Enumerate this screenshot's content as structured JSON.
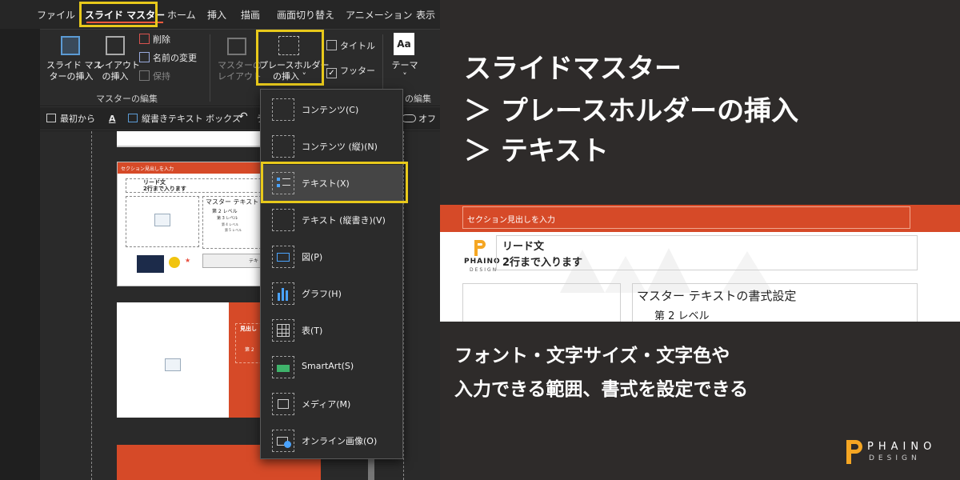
{
  "menubar": {
    "tabs": [
      "ファイル",
      "スライド マスター",
      "ホーム",
      "挿入",
      "描画",
      "画面切り替え",
      "アニメーション",
      "表示"
    ],
    "active_tab": "スライド マスター",
    "accent": "#ff5a3c"
  },
  "ribbon": {
    "insert_slide_master": [
      "スライド マス",
      "ターの挿入"
    ],
    "insert_layout": [
      "レイアウト",
      "の挿入"
    ],
    "delete": "削除",
    "rename": "名前の変更",
    "preserve": "保持",
    "master_layout": [
      "マスターの",
      "レイアウト"
    ],
    "insert_placeholder": [
      "プレースホルダー",
      "の挿入 ˅"
    ],
    "title_checkbox": "タイトル",
    "footer_checkbox": "フッター",
    "theme": "テーマ",
    "theme_icon_text": "Aa",
    "group_master_edit": "マスターの編集",
    "group_master_edit_partial": "の編集"
  },
  "qat": {
    "from_start": "最初から",
    "vertical_textbox": "縦書きテキスト ボックス",
    "partial": "う",
    "toggle_label": "オフ"
  },
  "dropdown": {
    "items": [
      {
        "label": "コンテンツ(C)"
      },
      {
        "label": "コンテンツ (縦)(N)"
      },
      {
        "label": "テキスト(X)"
      },
      {
        "label": "テキスト (縦書き)(V)"
      },
      {
        "label": "図(P)"
      },
      {
        "label": "グラフ(H)"
      },
      {
        "label": "表(T)"
      },
      {
        "label": "SmartArt(S)"
      },
      {
        "label": "メディア(M)"
      },
      {
        "label": "オンライン画像(O)"
      }
    ],
    "highlighted": "テキスト(X)"
  },
  "thumbnails": {
    "section_heading": "セクション見出しを入力",
    "lead": "リード文",
    "lead_sub": "2行まで入ります",
    "master_text": "マスター テキスト",
    "level2": "第 2 レベル",
    "level3": "第 3 レベル",
    "level4": "第 4 レベル",
    "level5": "第 5 レベル",
    "text_short": "テキ",
    "heading_short": "見出し",
    "level2_short": "第 2"
  },
  "headline": {
    "line1": "スライドマスター",
    "line2": "＞ プレースホルダーの挿入",
    "line3": "＞ テキスト"
  },
  "zoom": {
    "section_heading": "セクション見出しを入力",
    "logo_name": "PHAINO",
    "logo_sub": "DESIGN",
    "lead": "リード文",
    "lead_sub": "2行まで入ります",
    "master_text": "マスター テキストの書式設定",
    "level2": "第 2 レベル"
  },
  "description": {
    "line1": "フォント・文字サイズ・文字色や",
    "line2": "入力できる範囲、書式を設定できる"
  },
  "brand": {
    "name": "PHAINO",
    "sub": "DESIGN",
    "color": "#f5a623",
    "highlight_color": "#e8c91b",
    "slide_orange": "#d64a28"
  }
}
